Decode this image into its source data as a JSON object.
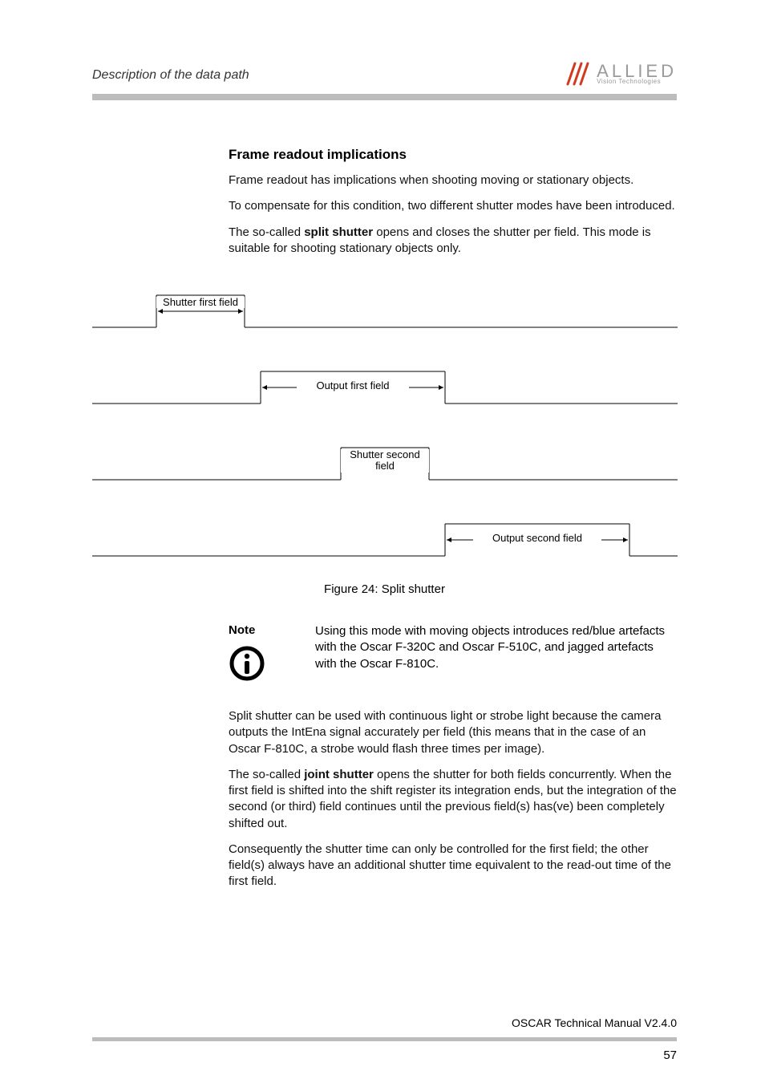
{
  "header": {
    "breadcrumb": "Description of the data path",
    "logo": {
      "brand": "ALLIED",
      "sub": "Vision Technologies"
    }
  },
  "section": {
    "title": "Frame readout implications",
    "p1": "Frame readout has implications when shooting moving or stationary objects.",
    "p2": "To compensate for this condition, two different shutter modes have been introduced.",
    "p3a": "The so-called ",
    "p3b": "split shutter",
    "p3c": " opens and closes the shutter per field. This mode is suitable for shooting stationary objects only."
  },
  "figure": {
    "labels": {
      "shutter_first": "Shutter first field",
      "output_first": "Output first field",
      "shutter_second": "Shutter second field",
      "output_second": "Output second field"
    },
    "caption": "Figure 24: Split shutter"
  },
  "note": {
    "label": "Note",
    "text": "Using this mode with moving objects introduces red/blue artefacts with the Oscar F-320C and Oscar F-510C, and jagged artefacts with the Oscar F-810C."
  },
  "after": {
    "p1": "Split shutter can be used with continuous light or strobe light because the camera outputs the IntEna signal accurately per field (this means that in the case of an Oscar F-810C, a strobe would flash three times per image).",
    "p2a": "The so-called ",
    "p2b": "joint shutter",
    "p2c": " opens the shutter for both fields concurrently. When the first field is shifted into the shift register its integration ends, but the integration of the second (or third) field continues until the previous field(s) has(ve) been completely shifted out.",
    "p3": "Consequently the shutter time can only be controlled for the first field; the other field(s) always have an additional shutter time equivalent to the read-out time of the first field."
  },
  "footer": {
    "text": "OSCAR Technical Manual V2.4.0",
    "page": "57"
  }
}
